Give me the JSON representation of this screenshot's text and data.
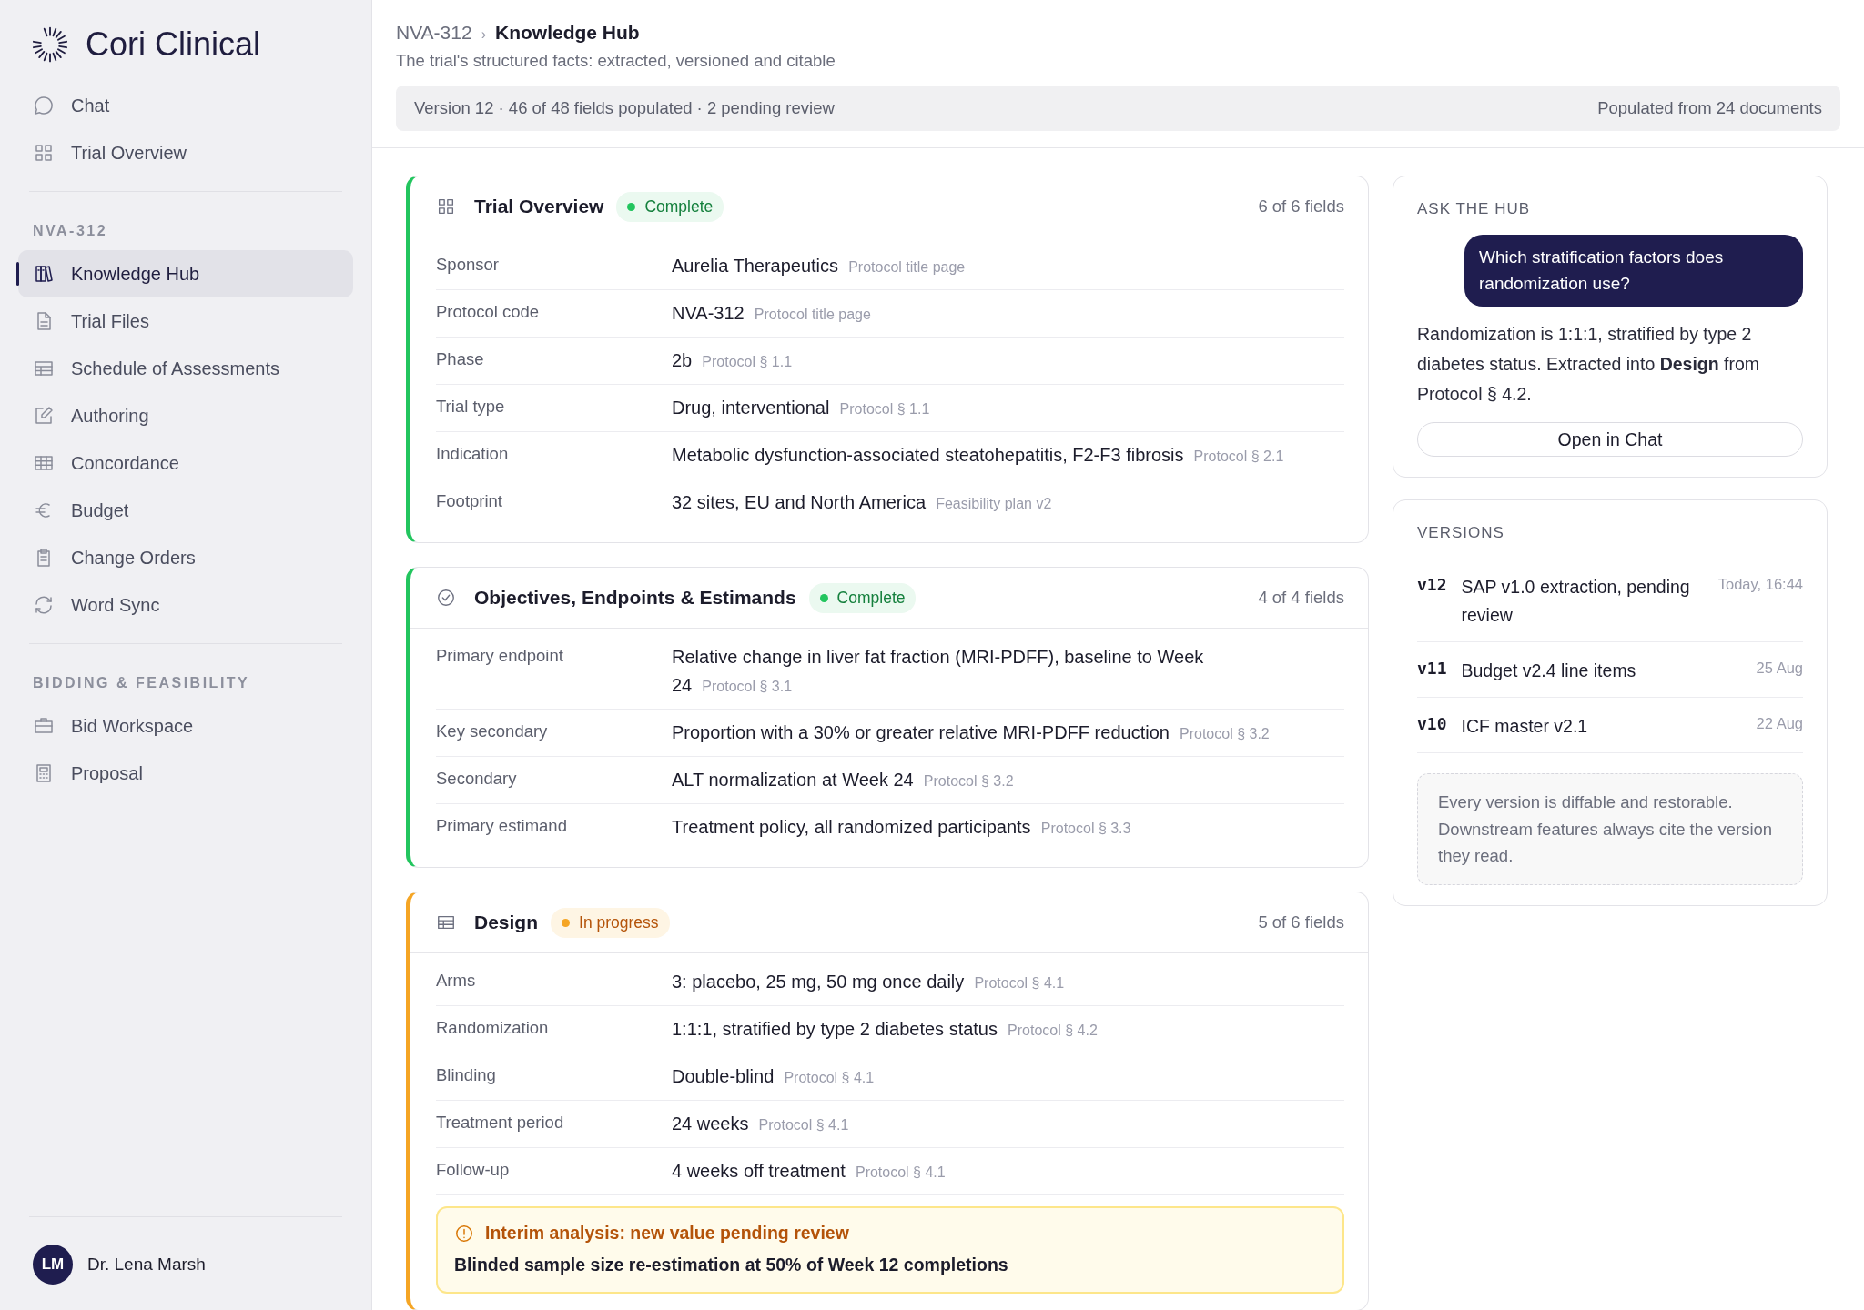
{
  "brand": {
    "name": "Cori Clinical"
  },
  "nav": {
    "items": [
      {
        "label": "Chat",
        "selected": false
      },
      {
        "label": "Trial Overview",
        "selected": false
      }
    ],
    "sections": [
      {
        "label": "NVA-312",
        "items": [
          {
            "label": "Knowledge Hub",
            "selected": true
          },
          {
            "label": "Trial Files",
            "selected": false
          },
          {
            "label": "Schedule of Assessments",
            "selected": false
          },
          {
            "label": "Authoring",
            "selected": false
          },
          {
            "label": "Concordance",
            "selected": false
          },
          {
            "label": "Budget",
            "selected": false
          },
          {
            "label": "Change Orders",
            "selected": false
          },
          {
            "label": "Word Sync",
            "selected": false
          }
        ]
      },
      {
        "label": "BIDDING & FEASIBILITY",
        "items": [
          {
            "label": "Bid Workspace",
            "selected": false
          },
          {
            "label": "Proposal",
            "selected": false
          }
        ]
      }
    ]
  },
  "user": {
    "initials": "LM",
    "name": "Dr. Lena Marsh"
  },
  "header": {
    "breadcrumb": {
      "parent": "NVA-312",
      "separator": "›",
      "current": "Knowledge Hub"
    },
    "subtitle": "The trial's structured facts: extracted, versioned and citable",
    "summary": {
      "left": "Version 12 · 46 of 48 fields populated · 2 pending review",
      "right": "Populated from 24 documents"
    }
  },
  "sections": [
    {
      "title": "Trial Overview",
      "status": {
        "label": "Complete",
        "kind": "complete"
      },
      "count": "6 of 6 fields",
      "fields": [
        {
          "label": "Sponsor",
          "value": "Aurelia Therapeutics",
          "source": "Protocol title page"
        },
        {
          "label": "Protocol code",
          "value": "NVA-312",
          "source": "Protocol title page"
        },
        {
          "label": "Phase",
          "value": "2b",
          "source": "Protocol § 1.1"
        },
        {
          "label": "Trial type",
          "value": "Drug, interventional",
          "source": "Protocol § 1.1"
        },
        {
          "label": "Indication",
          "value": "Metabolic dysfunction-associated steatohepatitis, F2-F3 fibrosis",
          "source": "Protocol § 2.1"
        },
        {
          "label": "Footprint",
          "value": "32 sites, EU and North America",
          "source": "Feasibility plan v2"
        }
      ]
    },
    {
      "title": "Objectives, Endpoints & Estimands",
      "status": {
        "label": "Complete",
        "kind": "complete"
      },
      "count": "4 of 4 fields",
      "fields": [
        {
          "label": "Primary endpoint",
          "value": "Relative change in liver fat fraction (MRI-PDFF), baseline to Week 24",
          "source": "Protocol § 3.1"
        },
        {
          "label": "Key secondary",
          "value": "Proportion with a 30% or greater relative MRI-PDFF reduction",
          "source": "Protocol § 3.2"
        },
        {
          "label": "Secondary",
          "value": "ALT normalization at Week 24",
          "source": "Protocol § 3.2"
        },
        {
          "label": "Primary estimand",
          "value": "Treatment policy, all randomized participants",
          "source": "Protocol § 3.3"
        }
      ]
    },
    {
      "title": "Design",
      "status": {
        "label": "In progress",
        "kind": "progress"
      },
      "count": "5 of 6 fields",
      "fields": [
        {
          "label": "Arms",
          "value": "3: placebo, 25 mg, 50 mg once daily",
          "source": "Protocol § 4.1"
        },
        {
          "label": "Randomization",
          "value": "1:1:1, stratified by type 2 diabetes status",
          "source": "Protocol § 4.2"
        },
        {
          "label": "Blinding",
          "value": "Double-blind",
          "source": "Protocol § 4.1"
        },
        {
          "label": "Treatment period",
          "value": "24 weeks",
          "source": "Protocol § 4.1"
        },
        {
          "label": "Follow-up",
          "value": "4 weeks off treatment",
          "source": "Protocol § 4.1"
        }
      ],
      "alert": {
        "title": "Interim analysis: new value pending review",
        "detail": "Blinded sample size re-estimation at 50% of Week 12 completions"
      }
    }
  ],
  "ask": {
    "heading": "ASK THE HUB",
    "question": "Which stratification factors does randomization use?",
    "answer": "Randomization is 1:1:1, stratified by type 2 diabetes status. Extracted into **Design** from Protocol § 4.2.",
    "button": "Open in Chat"
  },
  "versions": {
    "heading": "VERSIONS",
    "items": [
      {
        "version": "v12",
        "title": "SAP v1.0 extraction, pending review",
        "date": "Today, 16:44"
      },
      {
        "version": "v11",
        "title": "Budget v2.4 line items",
        "date": "25 Aug"
      },
      {
        "version": "v10",
        "title": "ICF master v2.1",
        "date": "22 Aug"
      }
    ],
    "note": "Every version is diffable and restorable. Downstream features always cite the version they read."
  }
}
